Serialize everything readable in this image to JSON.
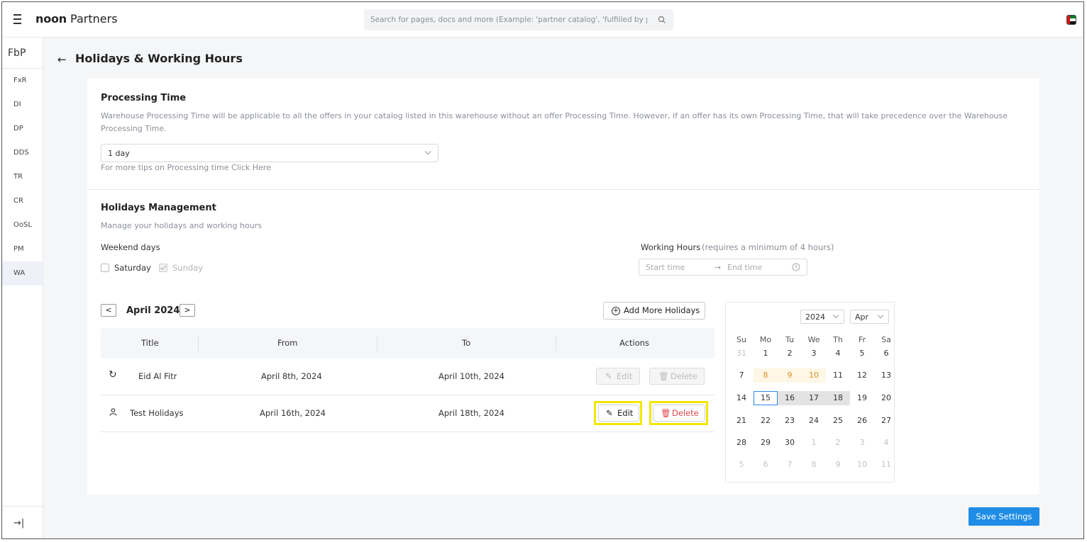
{
  "header": {
    "brand_bold": "noon",
    "brand_rest": " Partners",
    "search_placeholder": "Search for pages, docs and more (Example: 'partner catalog', 'fulfilled by p"
  },
  "sidebar": {
    "head": "FbP",
    "items": [
      {
        "label": "FxR"
      },
      {
        "label": "DI"
      },
      {
        "label": "DP"
      },
      {
        "label": "DDS"
      },
      {
        "label": "TR"
      },
      {
        "label": "CR"
      },
      {
        "label": "OoSL"
      },
      {
        "label": "PM"
      },
      {
        "label": "WA"
      }
    ]
  },
  "page": {
    "title": "Holidays & Working Hours"
  },
  "processing": {
    "title": "Processing Time",
    "desc_line1": "Warehouse Processing Time will be applicable to all the offers in your catalog listed in this warehouse without an offer Processing Time. However, if an offer has its own Processing Time, that will take precedence over the Warehouse",
    "desc_line2": "Processing Time.",
    "selected": "1 day",
    "tip": "For more tips on Processing time Click Here"
  },
  "holidays": {
    "title": "Holidays Management",
    "desc": "Manage your holidays and working hours",
    "weekend_label": "Weekend days",
    "saturday": "Saturday",
    "sunday": "Sunday",
    "working_hours_label": "Working Hours",
    "working_hours_note": "(requires a minimum of 4 hours)",
    "start_placeholder": "Start time",
    "end_placeholder": "End time",
    "month": "April 2024",
    "add_button": "Add More Holidays",
    "columns": [
      "Title",
      "From",
      "To",
      "Actions"
    ],
    "rows": [
      {
        "title": "Eid Al Fitr",
        "from": "April 8th, 2024",
        "to": "April 10th, 2024",
        "edit": "Edit",
        "delete": "Delete"
      },
      {
        "title": "Test Holidays",
        "from": "April 16th, 2024",
        "to": "April 18th, 2024",
        "edit": "Edit",
        "delete": "Delete"
      }
    ]
  },
  "calendar": {
    "year": "2024",
    "month": "Apr",
    "dow": [
      "Su",
      "Mo",
      "Tu",
      "We",
      "Th",
      "Fr",
      "Sa"
    ],
    "weeks": [
      [
        "31",
        "1",
        "2",
        "3",
        "4",
        "5",
        "6"
      ],
      [
        "7",
        "8",
        "9",
        "10",
        "11",
        "12",
        "13"
      ],
      [
        "14",
        "15",
        "16",
        "17",
        "18",
        "19",
        "20"
      ],
      [
        "21",
        "22",
        "23",
        "24",
        "25",
        "26",
        "27"
      ],
      [
        "28",
        "29",
        "30",
        "1",
        "2",
        "3",
        "4"
      ],
      [
        "5",
        "6",
        "7",
        "8",
        "9",
        "10",
        "11"
      ]
    ]
  },
  "save_button": "Save Settings",
  "colors": {
    "primary": "#1f8de6",
    "danger": "#e0474c",
    "highlight": "#f5e600",
    "holiday": "#d7912a"
  }
}
